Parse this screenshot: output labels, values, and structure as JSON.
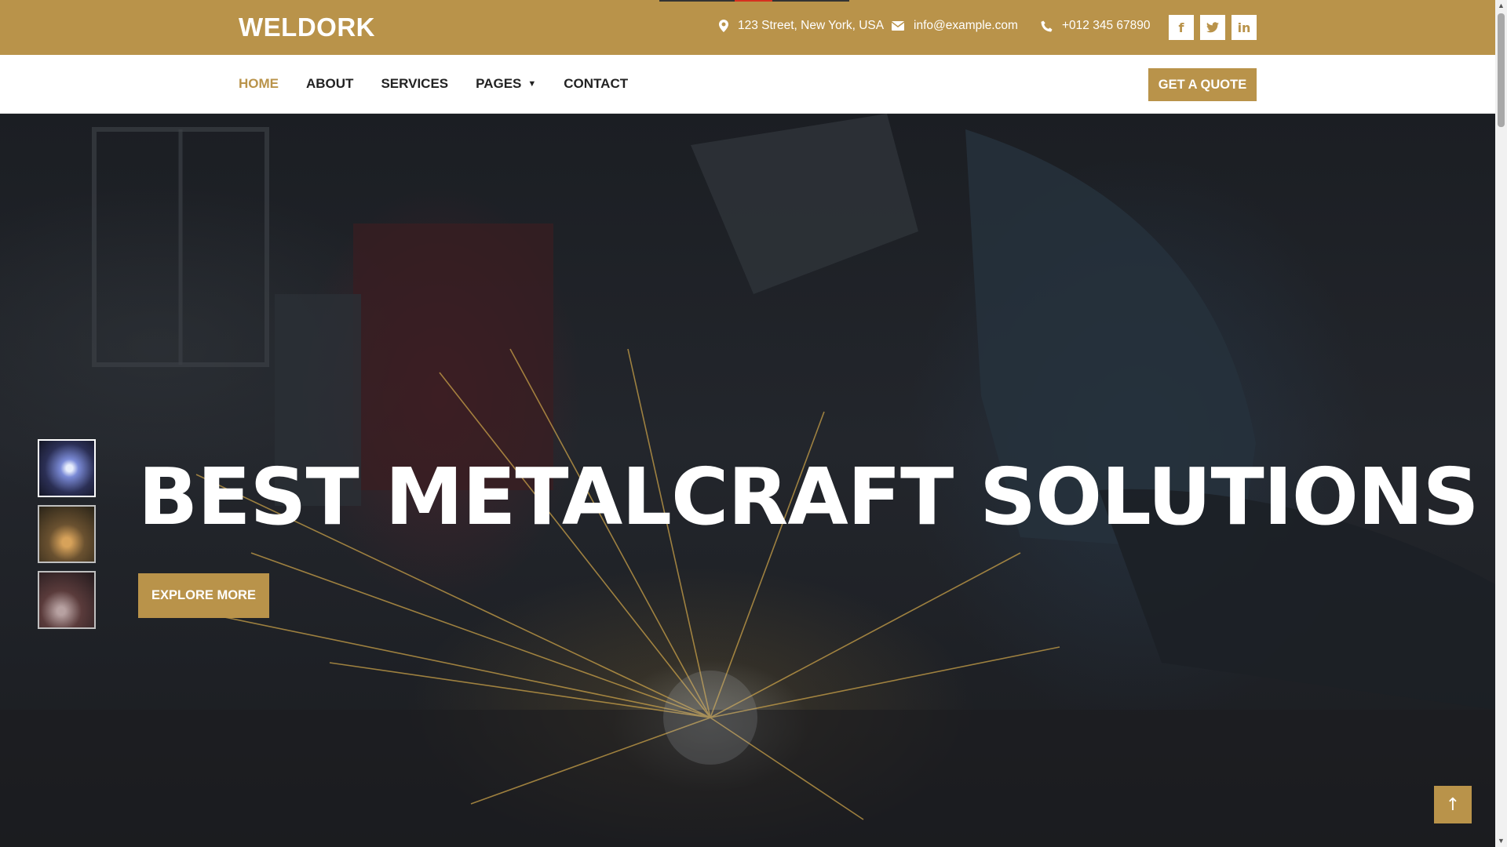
{
  "brand": "WELDORK",
  "topbar": {
    "address": "123 Street, New York, USA",
    "email": "info@example.com",
    "phone": "+012 345 67890",
    "socials": [
      {
        "icon": "facebook-icon",
        "glyph": "f"
      },
      {
        "icon": "twitter-icon",
        "glyph": "t"
      },
      {
        "icon": "linkedin-icon",
        "glyph": "in"
      }
    ]
  },
  "nav": {
    "items": [
      {
        "label": "HOME",
        "active": true
      },
      {
        "label": "ABOUT"
      },
      {
        "label": "SERVICES"
      },
      {
        "label": "PAGES",
        "dropdown": true
      },
      {
        "label": "CONTACT"
      }
    ],
    "cta": "GET A QUOTE"
  },
  "hero": {
    "title": "BEST METALCRAFT SOLUTIONS",
    "button": "EXPLORE MORE"
  },
  "colors": {
    "accent": "#b9934a",
    "text_dark": "#222222",
    "white": "#ffffff"
  },
  "back_to_top": "↑"
}
